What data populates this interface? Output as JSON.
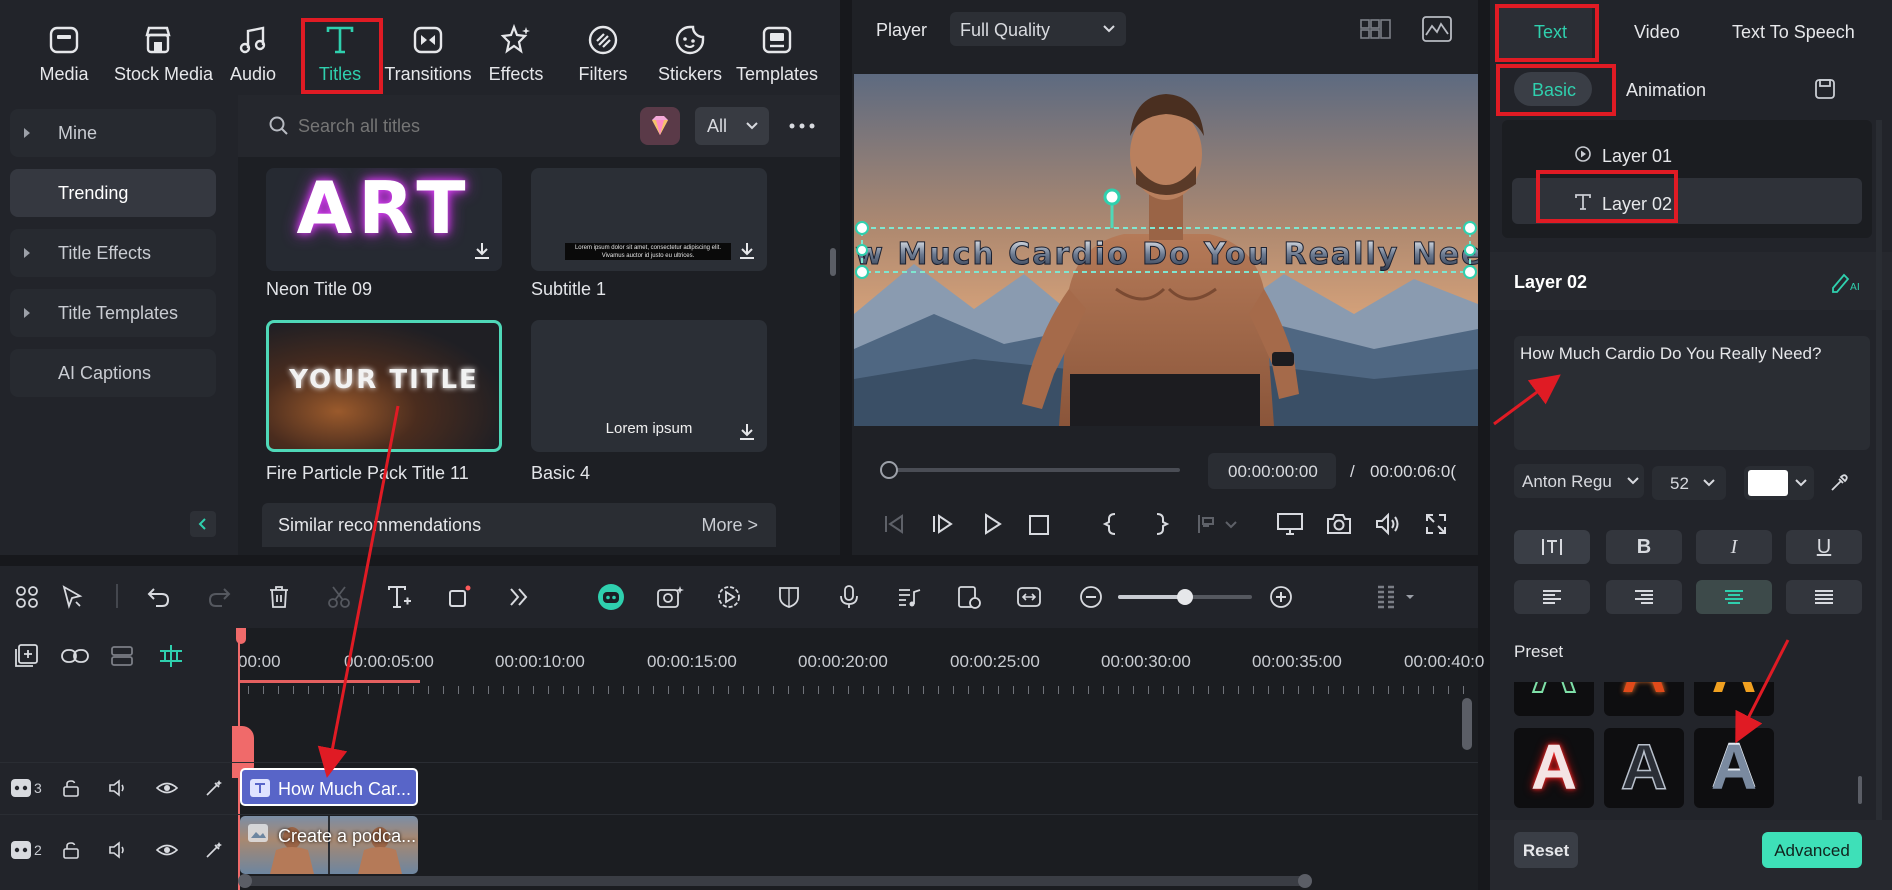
{
  "toolbar": {
    "items": [
      {
        "label": "Media",
        "icon": "media-icon"
      },
      {
        "label": "Stock Media",
        "icon": "stock-media-icon"
      },
      {
        "label": "Audio",
        "icon": "audio-icon"
      },
      {
        "label": "Titles",
        "icon": "titles-icon"
      },
      {
        "label": "Transitions",
        "icon": "transitions-icon"
      },
      {
        "label": "Effects",
        "icon": "effects-icon"
      },
      {
        "label": "Filters",
        "icon": "filters-icon"
      },
      {
        "label": "Stickers",
        "icon": "stickers-icon"
      },
      {
        "label": "Templates",
        "icon": "templates-icon"
      }
    ],
    "active": "Titles"
  },
  "leftnav": {
    "items": [
      {
        "label": "Mine"
      },
      {
        "label": "Trending"
      },
      {
        "label": "Title Effects"
      },
      {
        "label": "Title Templates"
      },
      {
        "label": "AI Captions"
      }
    ]
  },
  "search": {
    "placeholder": "Search all titles",
    "filter": "All"
  },
  "titles": [
    {
      "name": "Neon Title 09",
      "preview_text": "ART"
    },
    {
      "name": "Subtitle 1",
      "preview_text": "Lorem ipsum dolor sit amet, consectetur adipiscing elit. Vivamus auctor id justo eu ultrices."
    },
    {
      "name": "Fire Particle Pack Title 11",
      "preview_text": "YOUR TITLE"
    },
    {
      "name": "Basic 4",
      "preview_text": "Lorem ipsum"
    }
  ],
  "similar": {
    "label": "Similar recommendations",
    "more": "More >"
  },
  "player": {
    "label": "Player",
    "quality": "Full Quality",
    "overlay_text": "How Much Cardio Do You Really Need?",
    "current_time": "00:00:00:00",
    "separator": "/",
    "total_time": "00:00:06:0("
  },
  "right": {
    "tabs": [
      "Text",
      "Video",
      "Text To Speech"
    ],
    "subtabs": [
      "Basic",
      "Animation"
    ],
    "layers": [
      "Layer 01",
      "Layer 02"
    ],
    "section_title": "Layer 02",
    "text_value": "How Much Cardio Do You Really Need?",
    "font": "Anton Regu",
    "size": "52",
    "bold": "B",
    "italic": "I",
    "underline": "U",
    "preset_label": "Preset",
    "preset_glyph": "A",
    "reset": "Reset",
    "advanced": "Advanced"
  },
  "timeline": {
    "ruler": [
      "00:00",
      "00:00:05:00",
      "00:00:10:00",
      "00:00:15:00",
      "00:00:20:00",
      "00:00:25:00",
      "00:00:30:00",
      "00:00:35:00",
      "00:00:40:0"
    ],
    "tracks": [
      {
        "number": "3",
        "clip": "How Much Car..."
      },
      {
        "number": "2",
        "clip": "Create a podca..."
      }
    ]
  },
  "colors": {
    "accent": "#2fd0ae",
    "highlight_red": "#e01b24",
    "title_clip": "#5865c8"
  }
}
